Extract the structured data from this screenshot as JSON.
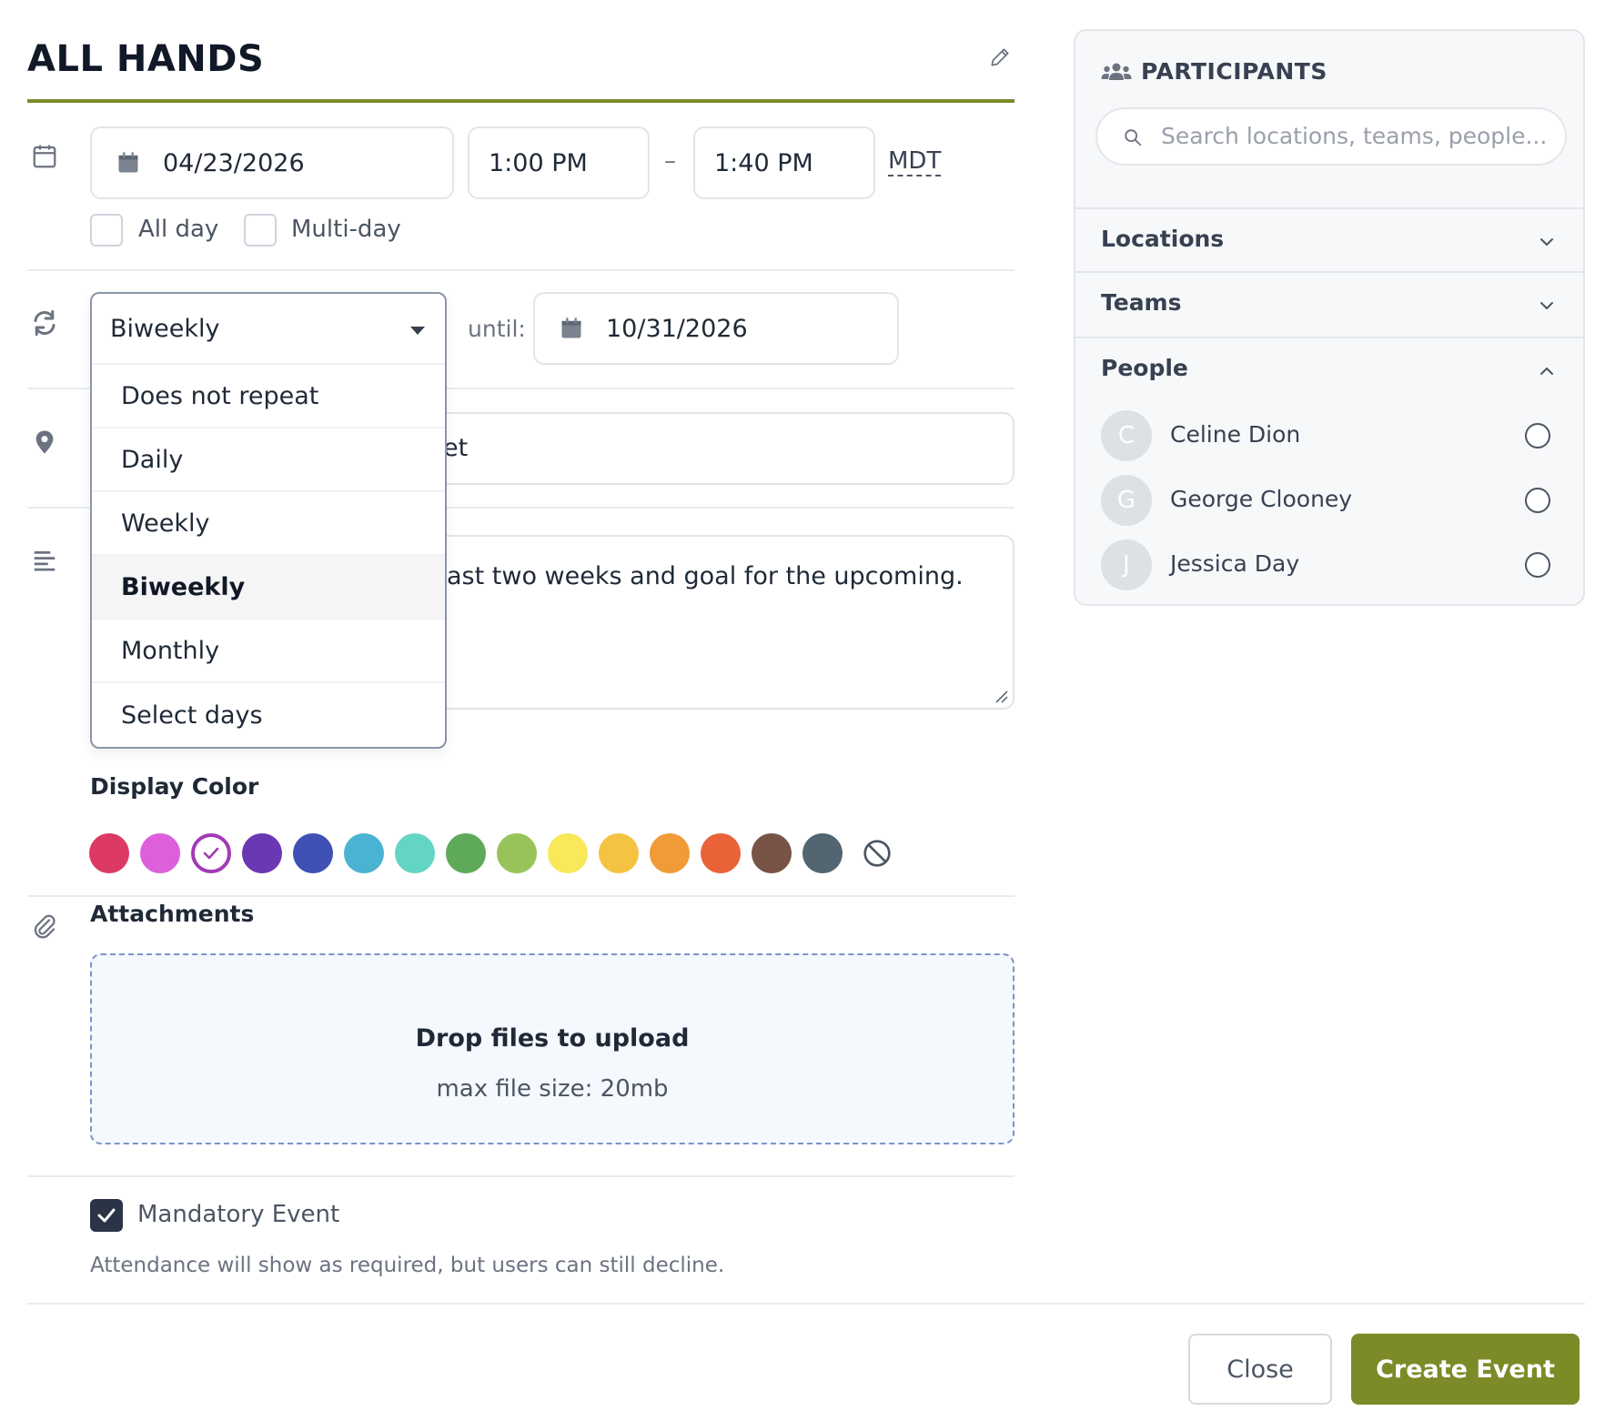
{
  "event": {
    "title": "ALL HANDS",
    "start_date": "04/23/2026",
    "start_time": "1:00 PM",
    "time_separator": "–",
    "end_time": "1:40 PM",
    "timezone": "MDT",
    "all_day_label": "All day",
    "multi_day_label": "Multi-day",
    "all_day_checked": false,
    "multi_day_checked": false
  },
  "repeat": {
    "selected": "Biweekly",
    "options": [
      "Does not repeat",
      "Daily",
      "Weekly",
      "Biweekly",
      "Monthly",
      "Select days"
    ],
    "until_label": "until:",
    "until_date": "10/31/2026"
  },
  "location": {
    "visible_value_fragment": "et"
  },
  "description": {
    "visible_text_fragment": "ast two weeks and goal for the upcoming."
  },
  "display_color": {
    "label": "Display Color",
    "selected": "#a23bb5",
    "swatches": [
      "#dc3a64",
      "#dd5fdb",
      "#a23bb5",
      "#6a38b2",
      "#3f51b5",
      "#4ab3d1",
      "#63d5c5",
      "#5fa95a",
      "#98c35a",
      "#f8e85a",
      "#f5c342",
      "#f09b38",
      "#ea6238",
      "#785447",
      "#536570"
    ],
    "none_icon": "no-color-icon"
  },
  "attachments": {
    "label": "Attachments",
    "drop_title": "Drop files to upload",
    "drop_sub": "max file size: 20mb"
  },
  "mandatory": {
    "label": "Mandatory Event",
    "checked": true,
    "help": "Attendance will show as required, but users can still decline."
  },
  "participants": {
    "title": "PARTICIPANTS",
    "search_placeholder": "Search locations, teams, people...",
    "sections": [
      {
        "label": "Locations",
        "expanded": false
      },
      {
        "label": "Teams",
        "expanded": false
      },
      {
        "label": "People",
        "expanded": true
      }
    ],
    "people": [
      {
        "initial": "C",
        "name": "Celine Dion"
      },
      {
        "initial": "G",
        "name": "George Clooney"
      },
      {
        "initial": "J",
        "name": "Jessica Day"
      }
    ]
  },
  "footer": {
    "close_label": "Close",
    "create_label": "Create Event"
  },
  "colors": {
    "accent": "#7d8a28",
    "dropdown_border": "#8a96a8",
    "dropzone_border": "#7d93c9"
  }
}
